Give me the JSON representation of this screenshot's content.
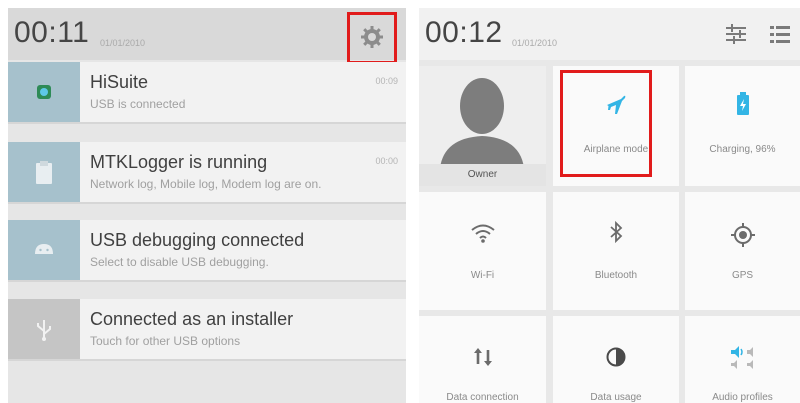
{
  "left": {
    "time": "00:11",
    "date": "01/01/2010",
    "settings_icon": "gear-icon",
    "notifications": [
      {
        "title": "HiSuite",
        "subtitle": "USB is connected",
        "time": "00:09",
        "icon": "hisuite-icon",
        "icon_color": "#a6c1cc"
      },
      {
        "title": "MTKLogger is running",
        "subtitle": "Network log, Mobile log, Modem log are on.",
        "time": "00:00",
        "icon": "clipboard-icon",
        "icon_color": "#a6c1cc"
      },
      {
        "title": "USB debugging connected",
        "subtitle": "Select to disable USB debugging.",
        "time": "",
        "icon": "android-icon",
        "icon_color": "#a6c1cc"
      },
      {
        "title": "Connected as an installer",
        "subtitle": "Touch for other USB options",
        "time": "",
        "icon": "usb-icon",
        "icon_color": "#c5c5c5"
      }
    ]
  },
  "right": {
    "time": "00:12",
    "date": "01/01/2010",
    "header_icons": [
      "sliders-icon",
      "list-icon"
    ],
    "owner_label": "Owner",
    "tiles": [
      {
        "label": "Airplane mode",
        "icon": "airplane-icon",
        "highlighted": true
      },
      {
        "label": "Charging, 96%",
        "icon": "battery-charging-icon"
      },
      {
        "label": "Wi-Fi",
        "icon": "wifi-icon"
      },
      {
        "label": "Bluetooth",
        "icon": "bluetooth-icon"
      },
      {
        "label": "GPS",
        "icon": "gps-icon"
      },
      {
        "label": "Data connection",
        "icon": "data-connection-icon"
      },
      {
        "label": "Data usage",
        "icon": "data-usage-icon"
      },
      {
        "label": "Audio profiles",
        "icon": "audio-profiles-icon"
      }
    ]
  },
  "colors": {
    "accent": "#33b5e5",
    "highlight": "#e11b1b"
  }
}
